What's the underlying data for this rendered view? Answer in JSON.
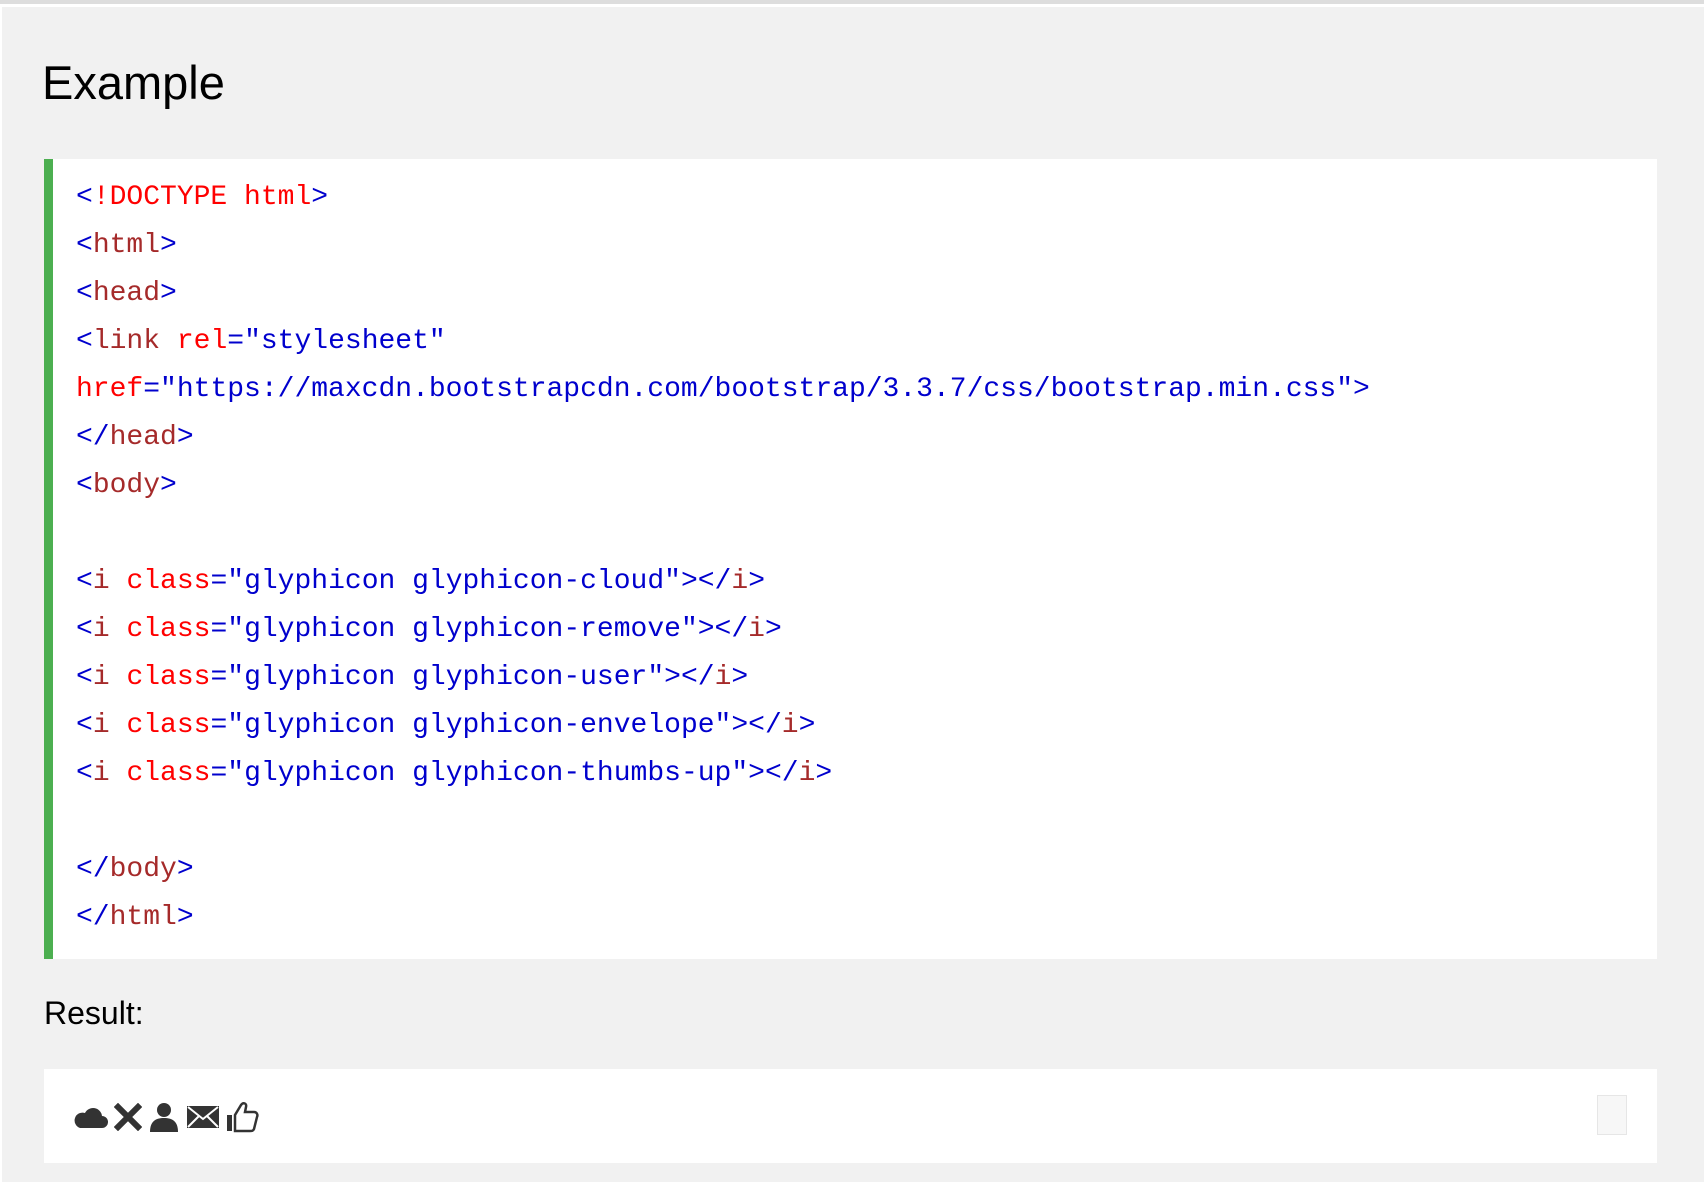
{
  "heading": "Example",
  "result_label": "Result:",
  "colors": {
    "code_border": "#4caf50",
    "tag": "#0000cd",
    "tag_name": "#a52a2a",
    "attribute": "#ff0000",
    "value": "#0000cd",
    "panel_bg": "#f1f1f1"
  },
  "code": {
    "l1": {
      "open": "<",
      "doctype": "!DOCTYPE html",
      "close": ">"
    },
    "l2": {
      "open": "<",
      "name": "html",
      "close": ">"
    },
    "l3": {
      "open": "<",
      "name": "head",
      "close": ">"
    },
    "l4": {
      "open": "<",
      "name": "link",
      "attr": "rel",
      "eq": "=",
      "val": "\"stylesheet\""
    },
    "l5": {
      "attr": "href",
      "eq": "=",
      "val": "\"https://maxcdn.bootstrapcdn.com/bootstrap/3.3.7/css/bootstrap.min.css\"",
      "close": ">"
    },
    "l6": {
      "open": "</",
      "name": "head",
      "close": ">"
    },
    "l7": {
      "open": "<",
      "name": "body",
      "close": ">"
    },
    "l9": {
      "open": "<",
      "name": "i",
      "attr": "class",
      "eq": "=",
      "val": "\"glyphicon glyphicon-cloud\"",
      "mid": "></",
      "name2": "i",
      "close": ">"
    },
    "l10": {
      "open": "<",
      "name": "i",
      "attr": "class",
      "eq": "=",
      "val": "\"glyphicon glyphicon-remove\"",
      "mid": "></",
      "name2": "i",
      "close": ">"
    },
    "l11": {
      "open": "<",
      "name": "i",
      "attr": "class",
      "eq": "=",
      "val": "\"glyphicon glyphicon-user\"",
      "mid": "></",
      "name2": "i",
      "close": ">"
    },
    "l12": {
      "open": "<",
      "name": "i",
      "attr": "class",
      "eq": "=",
      "val": "\"glyphicon glyphicon-envelope\"",
      "mid": "></",
      "name2": "i",
      "close": ">"
    },
    "l13": {
      "open": "<",
      "name": "i",
      "attr": "class",
      "eq": "=",
      "val": "\"glyphicon glyphicon-thumbs-up\"",
      "mid": "></",
      "name2": "i",
      "close": ">"
    },
    "l15": {
      "open": "</",
      "name": "body",
      "close": ">"
    },
    "l16": {
      "open": "</",
      "name": "html",
      "close": ">"
    }
  },
  "result_icons": [
    "cloud-icon",
    "remove-icon",
    "user-icon",
    "envelope-icon",
    "thumbs-up-icon"
  ]
}
